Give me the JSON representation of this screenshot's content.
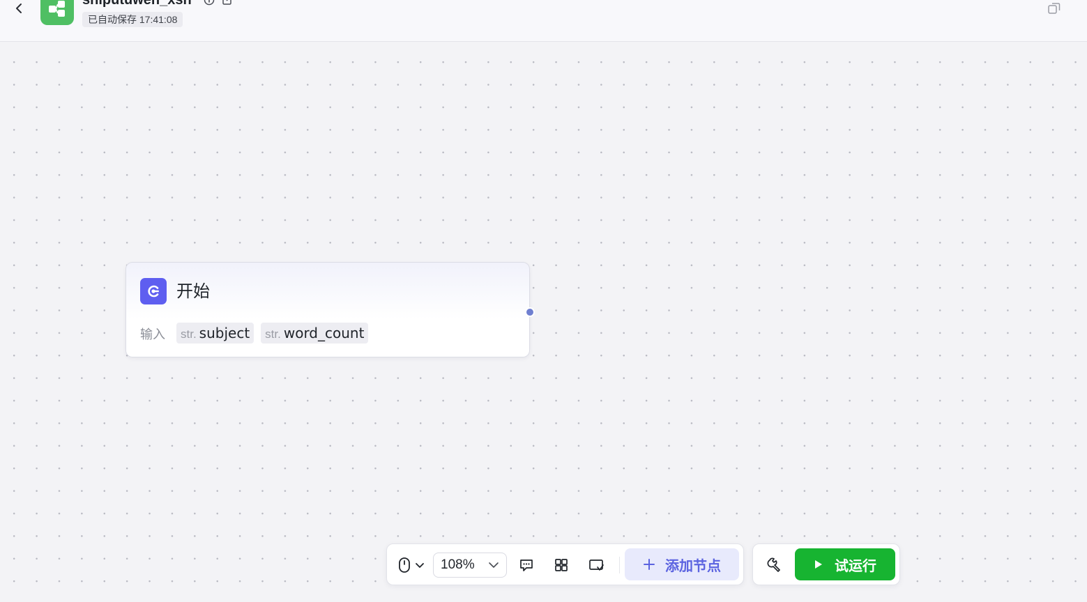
{
  "header": {
    "app_title": "shiputuwen_xsh",
    "autosave_text": "已自动保存 17:41:08"
  },
  "node": {
    "title": "开始",
    "input_label": "输入",
    "params": [
      {
        "type": "str.",
        "name": "subject"
      },
      {
        "type": "str.",
        "name": "word_count"
      }
    ]
  },
  "toolbar": {
    "zoom": "108%",
    "add_node_label": "添加节点",
    "run_label": "试运行"
  },
  "colors": {
    "logo": "#4fbf63",
    "node_icon": "#5e5ef0",
    "accent": "#5b63e0",
    "run": "#17b431",
    "port": "#6f7fd0"
  },
  "icons": [
    "back-chevron-icon",
    "app-logo-icon",
    "info-icon",
    "edit-icon",
    "window-icon",
    "start-node-icon",
    "mouse-icon",
    "chevron-down-icon",
    "comment-icon",
    "layout-grid-icon",
    "minimap-icon",
    "plus-icon",
    "wrench-icon",
    "play-icon"
  ]
}
